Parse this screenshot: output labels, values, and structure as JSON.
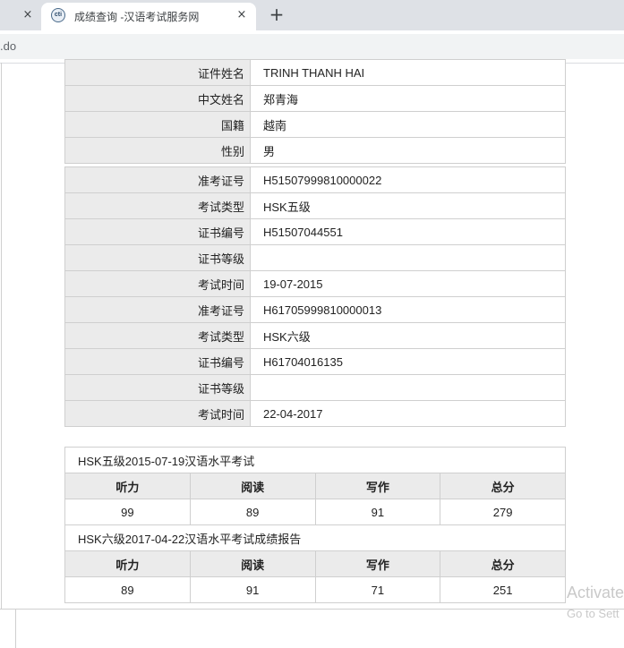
{
  "browser": {
    "tab_title": "成绩查询 -汉语考试服务网",
    "favicon_text": "cti",
    "close_glyph": "×",
    "new_tab_glyph": "+",
    "address_fragment": ".do"
  },
  "info": [
    {
      "label": "证件姓名",
      "value": "TRINH THANH HAI"
    },
    {
      "label": "中文姓名",
      "value": "郑青海"
    },
    {
      "label": "国籍",
      "value": "越南"
    },
    {
      "label": "性别",
      "value": "男"
    }
  ],
  "exams": [
    {
      "label": "准考证号",
      "value": "H51507999810000022"
    },
    {
      "label": "考试类型",
      "value": "HSK五级"
    },
    {
      "label": "证书编号",
      "value": "H51507044551"
    },
    {
      "label": "证书等级",
      "value": ""
    },
    {
      "label": "考试时间",
      "value": "19-07-2015"
    },
    {
      "label": "准考证号",
      "value": "H61705999810000013"
    },
    {
      "label": "考试类型",
      "value": "HSK六级"
    },
    {
      "label": "证书编号",
      "value": "H61704016135"
    },
    {
      "label": "证书等级",
      "value": ""
    },
    {
      "label": "考试时间",
      "value": "22-04-2017"
    }
  ],
  "score_tables": [
    {
      "caption": "HSK五级2015-07-19汉语水平考试",
      "headers": [
        "听力",
        "阅读",
        "写作",
        "总分"
      ],
      "values": [
        "99",
        "89",
        "91",
        "279"
      ]
    },
    {
      "caption": "HSK六级2017-04-22汉语水平考试成绩报告",
      "headers": [
        "听力",
        "阅读",
        "写作",
        "总分"
      ],
      "values": [
        "89",
        "91",
        "71",
        "251"
      ]
    }
  ],
  "watermark": {
    "line1": "Activate",
    "line2": "Go to Sett"
  }
}
